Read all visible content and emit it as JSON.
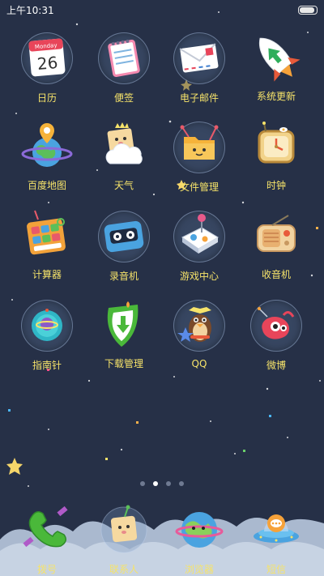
{
  "status_bar": {
    "time": "上午10:31",
    "battery_level": 1.0
  },
  "apps": [
    {
      "label": "日历",
      "icon": "calendar-icon",
      "calendar_month": "Monday",
      "calendar_day": "26"
    },
    {
      "label": "便签",
      "icon": "notes-icon"
    },
    {
      "label": "电子邮件",
      "icon": "mail-icon"
    },
    {
      "label": "系统更新",
      "icon": "rocket-icon"
    },
    {
      "label": "百度地图",
      "icon": "map-planet-icon"
    },
    {
      "label": "天气",
      "icon": "weather-icon"
    },
    {
      "label": "文件管理",
      "icon": "folder-icon"
    },
    {
      "label": "时钟",
      "icon": "clock-icon"
    },
    {
      "label": "计算器",
      "icon": "calculator-icon"
    },
    {
      "label": "录音机",
      "icon": "recorder-icon"
    },
    {
      "label": "游戏中心",
      "icon": "gamepad-icon"
    },
    {
      "label": "收音机",
      "icon": "radio-icon"
    },
    {
      "label": "指南针",
      "icon": "compass-icon"
    },
    {
      "label": "下载管理",
      "icon": "download-shield-icon"
    },
    {
      "label": "QQ",
      "icon": "qq-penguin-icon"
    },
    {
      "label": "微博",
      "icon": "weibo-icon"
    }
  ],
  "pages": {
    "count": 4,
    "active_index": 1
  },
  "dock": [
    {
      "label": "拨号",
      "icon": "phone-icon"
    },
    {
      "label": "联系人",
      "icon": "contacts-icon"
    },
    {
      "label": "浏览器",
      "icon": "browser-globe-icon"
    },
    {
      "label": "短信",
      "icon": "sms-ufo-icon"
    }
  ],
  "colors": {
    "background": "#263047",
    "label": "#f6e36a",
    "clouds": "#aab9cf"
  }
}
